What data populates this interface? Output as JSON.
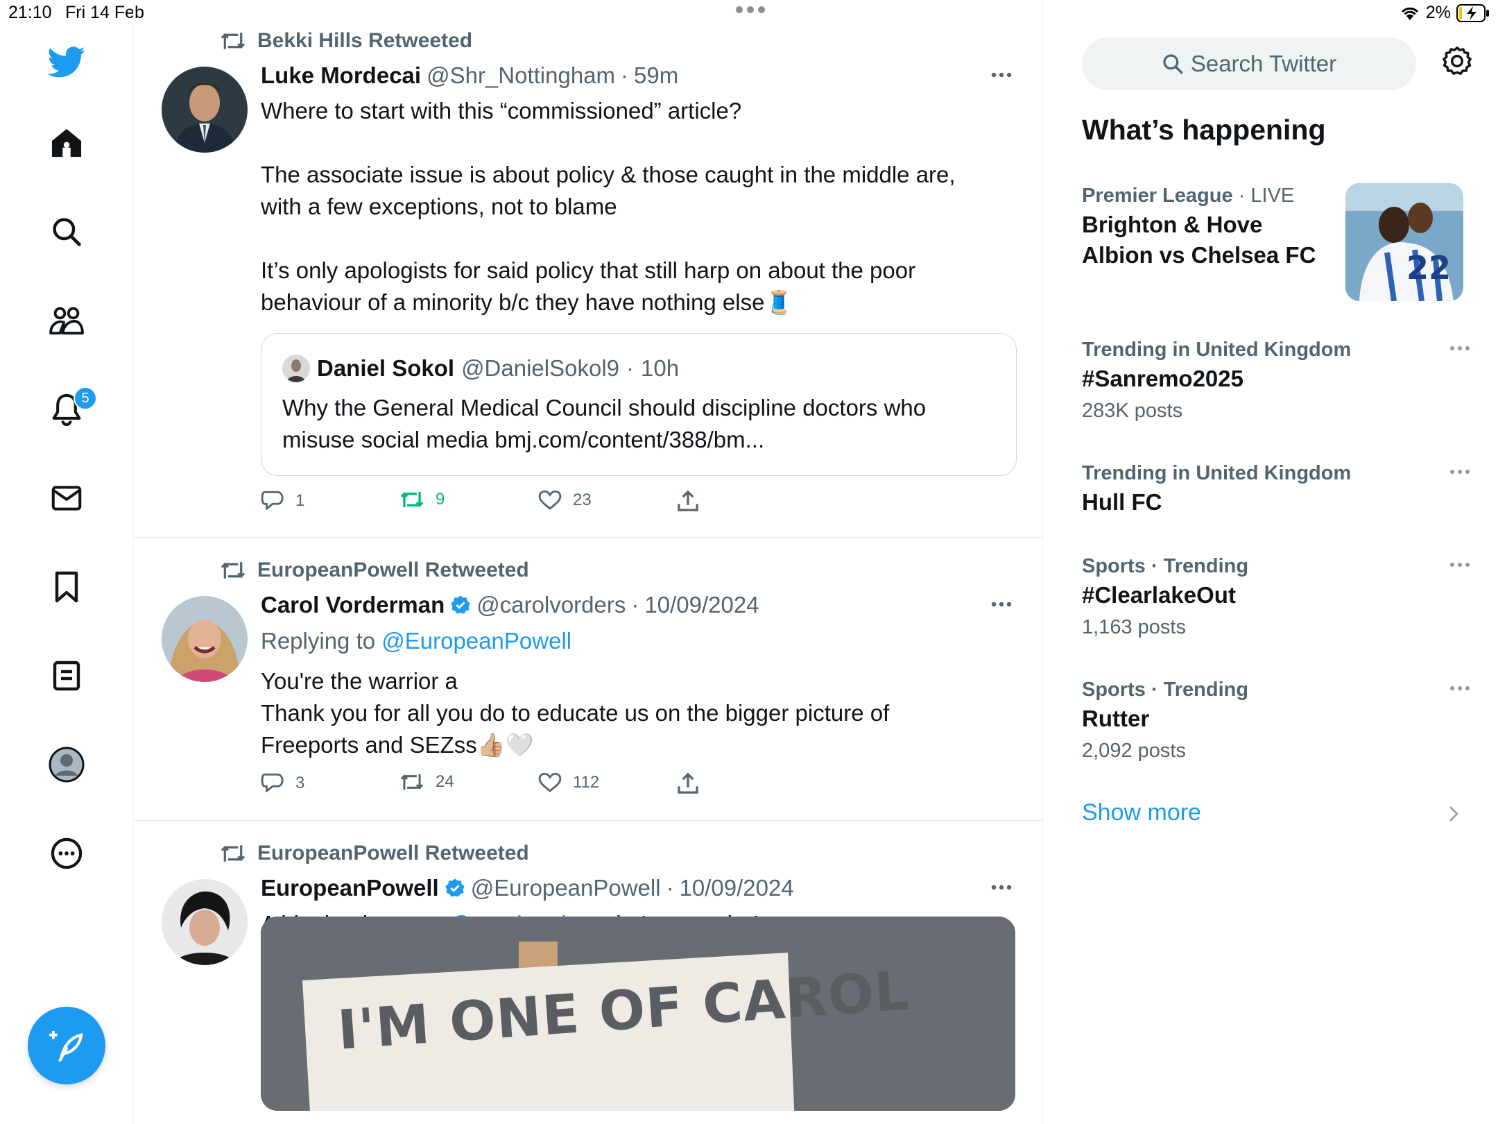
{
  "status_bar": {
    "time": "21:10",
    "date": "Fri 14 Feb",
    "battery": "2%"
  },
  "nav": {
    "notification_count": "5"
  },
  "tweets": [
    {
      "retweeted_by": "Bekki Hills Retweeted",
      "name": "Luke Mordecai",
      "handle": "@Shr_Nottingham",
      "sep": "·",
      "time": "59m",
      "para1": "Where to start with this “commissioned” article?",
      "para2a": "The associate issue is about policy & those caught in the middle are,",
      "para2b": "with a few exceptions, not to blame",
      "para3a": "It’s only apologists for said policy that still harp on about the poor",
      "para3b": "behaviour of a minority b/c they have nothing else",
      "emoji": "🧵",
      "quote": {
        "name": "Daniel Sokol",
        "handle": "@DanielSokol9",
        "time": "10h",
        "text_a": "Why the General Medical Council should discipline doctors who",
        "text_b": "misuse social media bmj.com/content/388/bm..."
      },
      "replies": "1",
      "retweets": "9",
      "likes": "23"
    },
    {
      "retweeted_by": "EuropeanPowell Retweeted",
      "name": "Carol Vorderman",
      "handle": "@carolvorders",
      "time": "10/09/2024",
      "replying_prefix": "Replying to",
      "replying_to": "@EuropeanPowell",
      "line1": "You're the warrior a",
      "line2": "Thank you for all you do to educate us on the bigger picture of",
      "line3": "Freeports and SEZss",
      "emoji": "👍🏼🤍",
      "replies": "3",
      "retweets": "24",
      "likes": "112"
    },
    {
      "retweeted_by": "EuropeanPowell Retweeted",
      "name": "EuropeanPowell",
      "handle": "@EuropeanPowell",
      "time": "10/09/2024",
      "text_a": "A big thank you to",
      "mention": "@carolvorders",
      "text_b": "she's a warrior!",
      "media_text": "I'M ONE OF CAROL"
    }
  ],
  "sidebar": {
    "search_placeholder": "Search Twitter",
    "title": "What’s happening",
    "featured": {
      "category": "Premier League",
      "live": "LIVE",
      "title_a": "Brighton & Hove",
      "title_b": "Albion vs Chelsea FC"
    },
    "trends": [
      {
        "meta": "Trending in United Kingdom",
        "name": "#Sanremo2025",
        "count": "283K posts"
      },
      {
        "meta": "Trending in United Kingdom",
        "name": "Hull FC",
        "count": ""
      },
      {
        "meta": "Sports · Trending",
        "name": "#ClearlakeOut",
        "count": "1,163 posts"
      },
      {
        "meta": "Sports · Trending",
        "name": "Rutter",
        "count": "2,092 posts"
      }
    ],
    "show_more": "Show more"
  },
  "colors": {
    "accent": "#1d9bf0",
    "retweet_active": "#00ba7c",
    "muted": "#536471"
  }
}
